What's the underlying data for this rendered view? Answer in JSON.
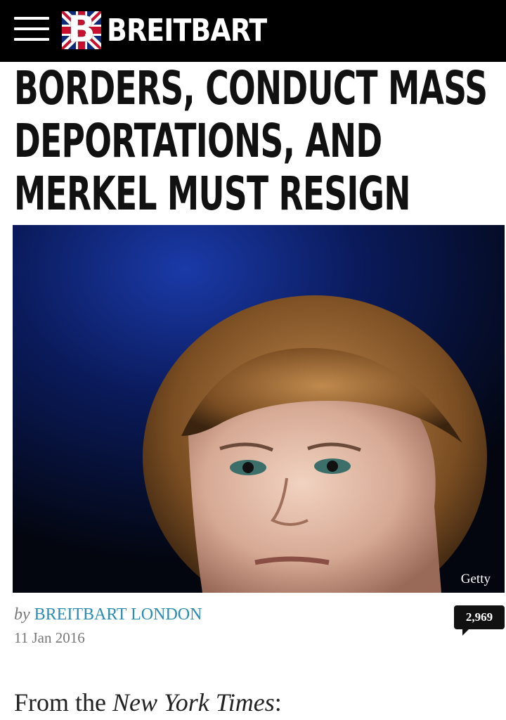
{
  "header": {
    "brand": "BREITBART",
    "logo_letter": "B",
    "menu_icon": "hamburger-menu-icon"
  },
  "article": {
    "headline_lines": [
      "BORDERS, CONDUCT MASS",
      "DEPORTATIONS, AND",
      "MERKEL MUST RESIGN"
    ],
    "image_credit": "Getty",
    "byline_prefix": "by",
    "author": "BREITBART LONDON",
    "date": "11 Jan 2016",
    "comment_count": "2,969",
    "lead_prefix": "From the ",
    "lead_source": "New York Times",
    "lead_suffix": ":"
  },
  "colors": {
    "header_bg": "#000000",
    "author_link": "#2a8bb3",
    "comment_badge": "#111111"
  }
}
